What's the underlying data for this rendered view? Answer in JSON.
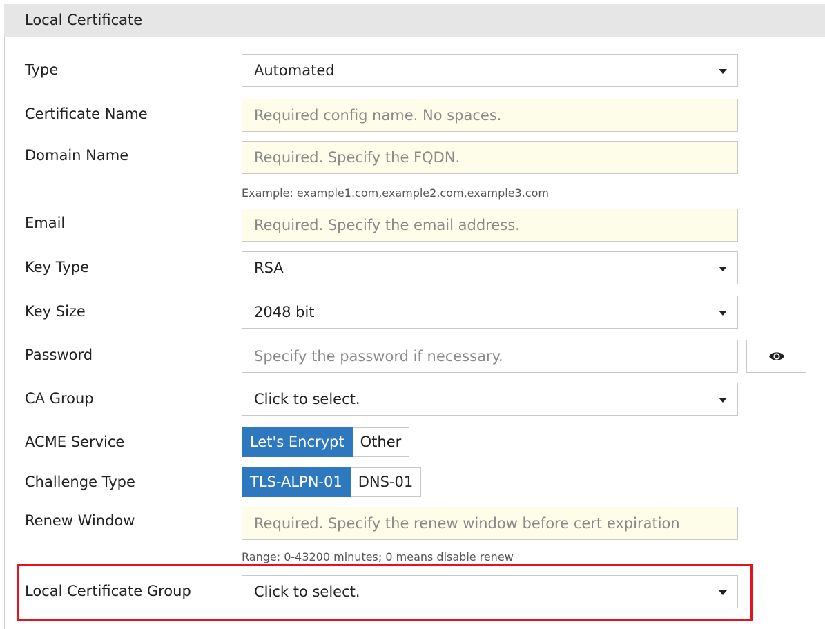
{
  "header": {
    "title": "Local Certificate"
  },
  "fields": {
    "type": {
      "label": "Type",
      "value": "Automated"
    },
    "cert_name": {
      "label": "Certificate Name",
      "placeholder": "Required config name. No spaces."
    },
    "domain_name": {
      "label": "Domain Name",
      "placeholder": "Required. Specify the FQDN.",
      "hint": "Example: example1.com,example2.com,example3.com"
    },
    "email": {
      "label": "Email",
      "placeholder": "Required. Specify the email address."
    },
    "key_type": {
      "label": "Key Type",
      "value": "RSA"
    },
    "key_size": {
      "label": "Key Size",
      "value": "2048 bit"
    },
    "password": {
      "label": "Password",
      "placeholder": "Specify the password if necessary."
    },
    "ca_group": {
      "label": "CA Group",
      "value": "Click to select."
    },
    "acme_service": {
      "label": "ACME Service",
      "options": [
        "Let's Encrypt",
        "Other"
      ],
      "selected": "Let's Encrypt"
    },
    "challenge_type": {
      "label": "Challenge Type",
      "options": [
        "TLS-ALPN-01",
        "DNS-01"
      ],
      "selected": "TLS-ALPN-01"
    },
    "renew_window": {
      "label": "Renew Window",
      "placeholder": "Required. Specify the renew window before cert expiration",
      "hint": "Range: 0-43200 minutes; 0 means disable renew"
    },
    "local_cert_group": {
      "label": "Local Certificate Group",
      "value": "Click to select."
    }
  },
  "icons": {
    "dropdown": "caret-down-icon",
    "reveal_password": "eye-icon"
  },
  "colors": {
    "accent": "#2e78c0",
    "required_bg": "#fdfde9",
    "highlight": "#e8141d",
    "header_bg": "#e6e6e6"
  }
}
